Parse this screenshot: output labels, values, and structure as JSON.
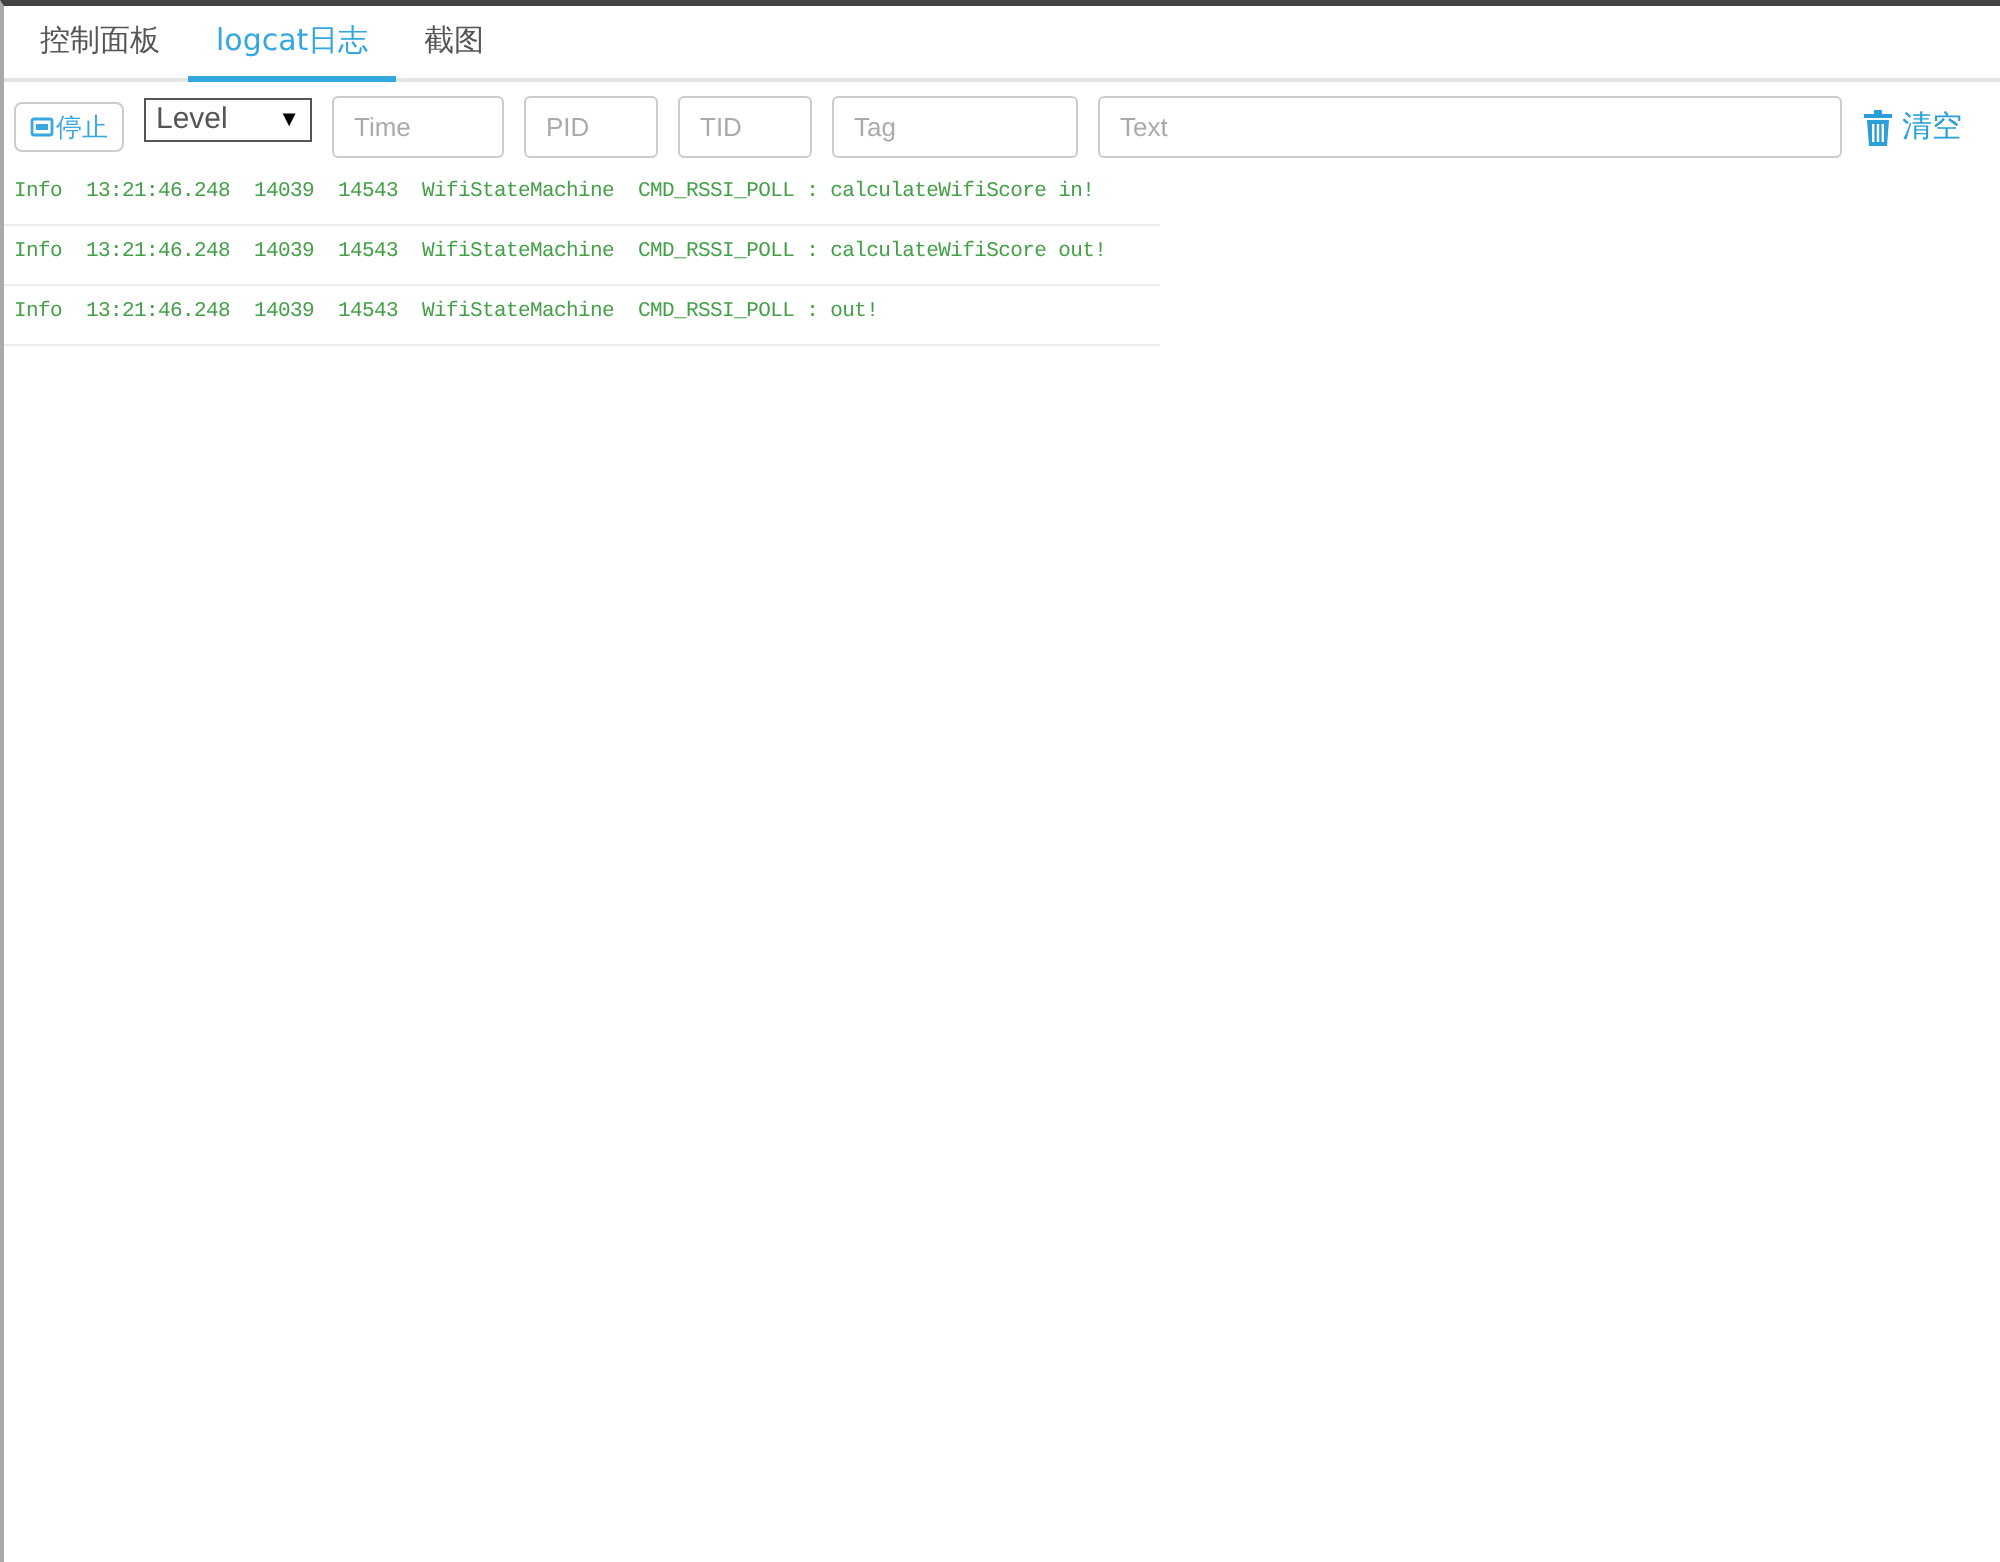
{
  "tabs": [
    {
      "label": "控制面板",
      "selected": false
    },
    {
      "label": "logcat日志",
      "selected": true
    },
    {
      "label": "截图",
      "selected": false
    }
  ],
  "toolbar": {
    "stop_button": "停止",
    "level_select": {
      "value": "Level",
      "arrow": "▼"
    },
    "filters": [
      {
        "placeholder": "Time",
        "kind": "time"
      },
      {
        "placeholder": "PID",
        "kind": "pid"
      },
      {
        "placeholder": "TID",
        "kind": "tid"
      },
      {
        "placeholder": "Tag",
        "kind": "tag"
      },
      {
        "placeholder": "Text",
        "kind": "text"
      }
    ],
    "clear_button": "清空"
  },
  "log_rows": [
    {
      "level": "Info",
      "time": "13:21:46.248",
      "pid": "14039",
      "tid": "14543",
      "tag": "WifiStateMachine",
      "message": "CMD_RSSI_POLL : calculateWifiScore in!"
    },
    {
      "level": "Info",
      "time": "13:21:46.248",
      "pid": "14039",
      "tid": "14543",
      "tag": "WifiStateMachine",
      "message": "CMD_RSSI_POLL : calculateWifiScore out!"
    },
    {
      "level": "Info",
      "time": "13:21:46.248",
      "pid": "14039",
      "tid": "14543",
      "tag": "WifiStateMachine",
      "message": "CMD_RSSI_POLL : out!"
    }
  ]
}
